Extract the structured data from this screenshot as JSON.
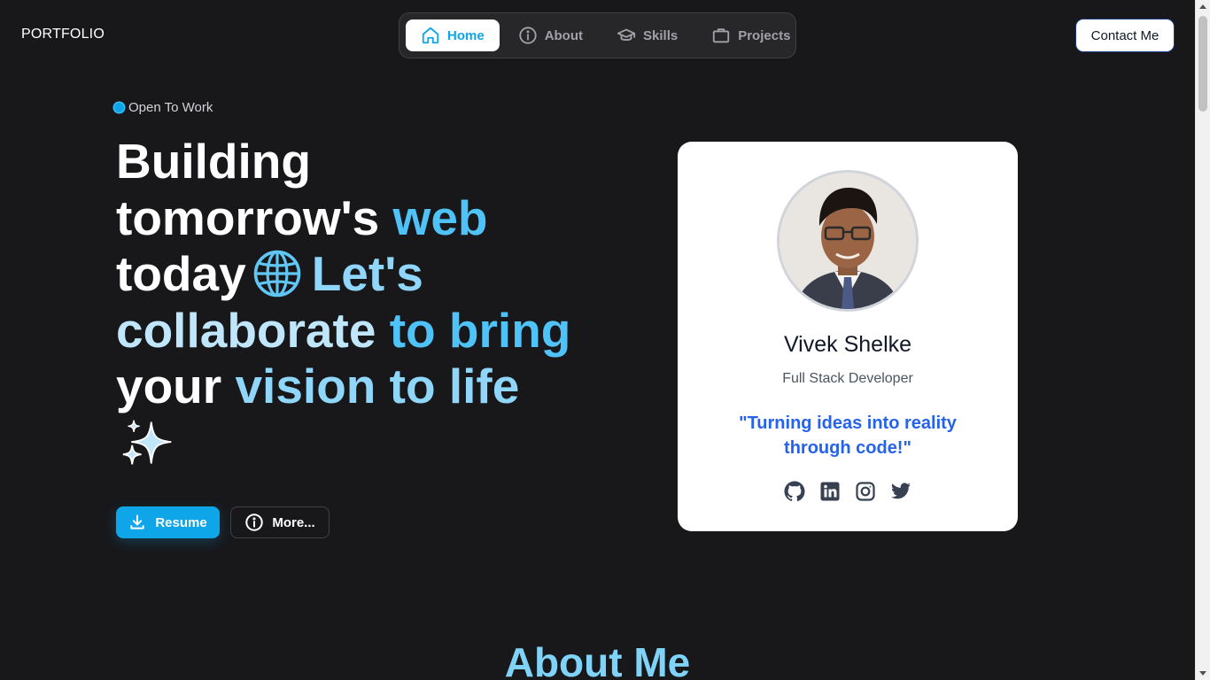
{
  "header": {
    "logo": "PORTFOLIO",
    "nav": [
      {
        "label": "Home",
        "icon": "home-icon",
        "active": true
      },
      {
        "label": "About",
        "icon": "info-icon",
        "active": false
      },
      {
        "label": "Skills",
        "icon": "graduation-cap-icon",
        "active": false
      },
      {
        "label": "Projects",
        "icon": "briefcase-icon",
        "active": false
      }
    ],
    "contact_label": "Contact Me"
  },
  "hero": {
    "status": "Open To Work",
    "headline": {
      "w1": "Building",
      "w2": "tomorrow's",
      "w3": "web",
      "w4": "today",
      "w5": "Let's",
      "w6": "collaborate",
      "w7": "to bring",
      "w8": "your",
      "w9": "vision to life"
    },
    "resume_label": "Resume",
    "more_label": "More..."
  },
  "profile": {
    "name": "Vivek Shelke",
    "role": "Full Stack Developer",
    "quote": "\"Turning ideas into reality through code!\"",
    "socials": [
      "github-icon",
      "linkedin-icon",
      "instagram-icon",
      "twitter-icon"
    ]
  },
  "about": {
    "title": "About Me"
  },
  "colors": {
    "background": "#18181b",
    "accent": "#0ea5e9",
    "quote": "#2563eb"
  }
}
